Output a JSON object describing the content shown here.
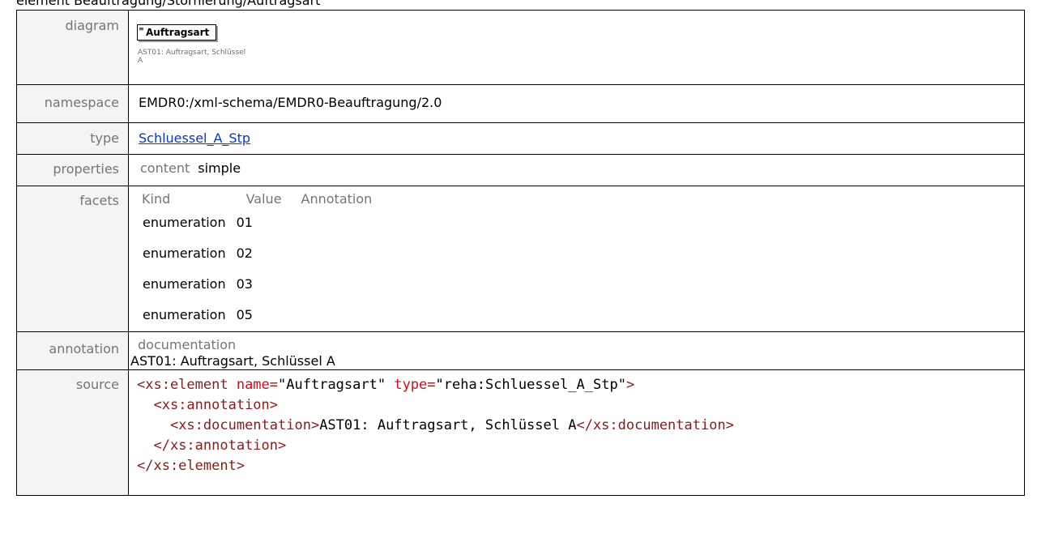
{
  "heading": "element Beauftragung/Stornierung/Auftragsart",
  "labels": {
    "diagram": "diagram",
    "namespace": "namespace",
    "type": "type",
    "properties": "properties",
    "facets": "facets",
    "annotation": "annotation",
    "source": "source"
  },
  "diagram": {
    "box_label": "Auftragsart",
    "box_glyph": "≡",
    "note": "AST01: Auftragsart, Schlüssel A"
  },
  "namespace": "EMDR0:/xml-schema/EMDR0-Beauftragung/2.0",
  "type": {
    "link_text": "Schluessel_A_Stp"
  },
  "properties": {
    "key": "content",
    "value": "simple"
  },
  "facets": {
    "headers": [
      "Kind",
      "Value",
      "Annotation"
    ],
    "rows": [
      {
        "kind": "enumeration",
        "value": "01",
        "annotation": ""
      },
      {
        "kind": "enumeration",
        "value": "02",
        "annotation": ""
      },
      {
        "kind": "enumeration",
        "value": "03",
        "annotation": ""
      },
      {
        "kind": "enumeration",
        "value": "05",
        "annotation": ""
      }
    ]
  },
  "annotation": {
    "key": "documentation",
    "value": "AST01: Auftragsart, Schlüssel A"
  },
  "source": {
    "line1": {
      "open": "<xs:element ",
      "a1": "name",
      "eq1": "=",
      "v1": "\"Auftragsart\"",
      "a2": "type",
      "eq2": "=",
      "v2": "\"reha:Schluessel_A_Stp\"",
      "close": ">"
    },
    "line2": "<xs:annotation>",
    "line3": {
      "open": "<xs:documentation>",
      "text": "AST01: Auftragsart, Schlüssel A",
      "close": "</xs:documentation>"
    },
    "line4": "</xs:annotation>",
    "line5": "</xs:element>"
  },
  "colors": {
    "label_bg": "#f4f4f4",
    "label_text": "#757575",
    "link": "#0a37c4",
    "xml_tag": "#8b1a1a",
    "xml_attr": "#d10c1c"
  }
}
